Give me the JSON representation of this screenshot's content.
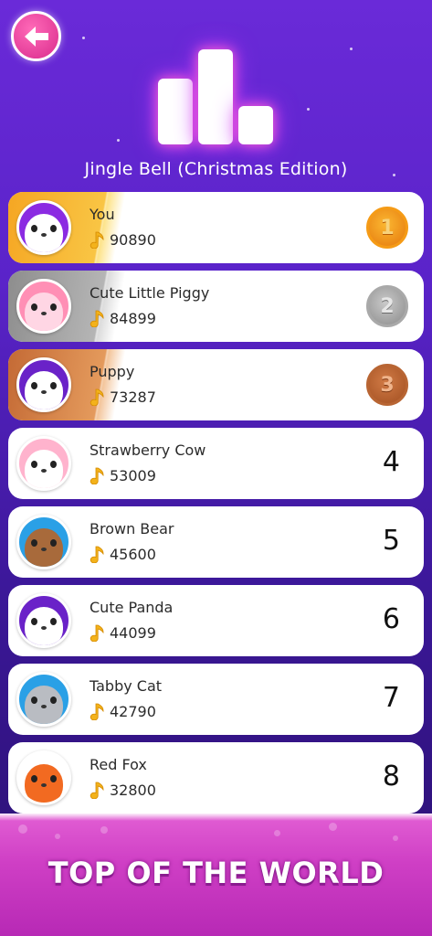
{
  "header": {
    "back_icon": "back-arrow-icon",
    "chart_icon": "leaderboard-chart-icon",
    "song_title": "Jingle Bell (Christmas Edition)"
  },
  "leaderboard": [
    {
      "name": "You",
      "score": "90890",
      "rank": "1",
      "medal": "gold",
      "avatar": "white-cat"
    },
    {
      "name": "Cute Little Piggy",
      "score": "84899",
      "rank": "2",
      "medal": "silver",
      "avatar": "pig"
    },
    {
      "name": "Puppy",
      "score": "73287",
      "rank": "3",
      "medal": "bronze",
      "avatar": "dalmatian"
    },
    {
      "name": "Strawberry Cow",
      "score": "53009",
      "rank": "4",
      "medal": null,
      "avatar": "cow"
    },
    {
      "name": "Brown Bear",
      "score": "45600",
      "rank": "5",
      "medal": null,
      "avatar": "bear"
    },
    {
      "name": "Cute Panda",
      "score": "44099",
      "rank": "6",
      "medal": null,
      "avatar": "panda"
    },
    {
      "name": "Tabby Cat",
      "score": "42790",
      "rank": "7",
      "medal": null,
      "avatar": "grey-cat"
    },
    {
      "name": "Red Fox",
      "score": "32800",
      "rank": "8",
      "medal": null,
      "avatar": "fox"
    }
  ],
  "score_icon": "music-note-icon",
  "footer": {
    "title": "TOP OF THE WORLD"
  },
  "colors": {
    "gold": "#f5a623",
    "silver": "#a9a9a9",
    "bronze": "#b86533",
    "background": "#5a23c9",
    "footer": "#cf3fc5"
  }
}
